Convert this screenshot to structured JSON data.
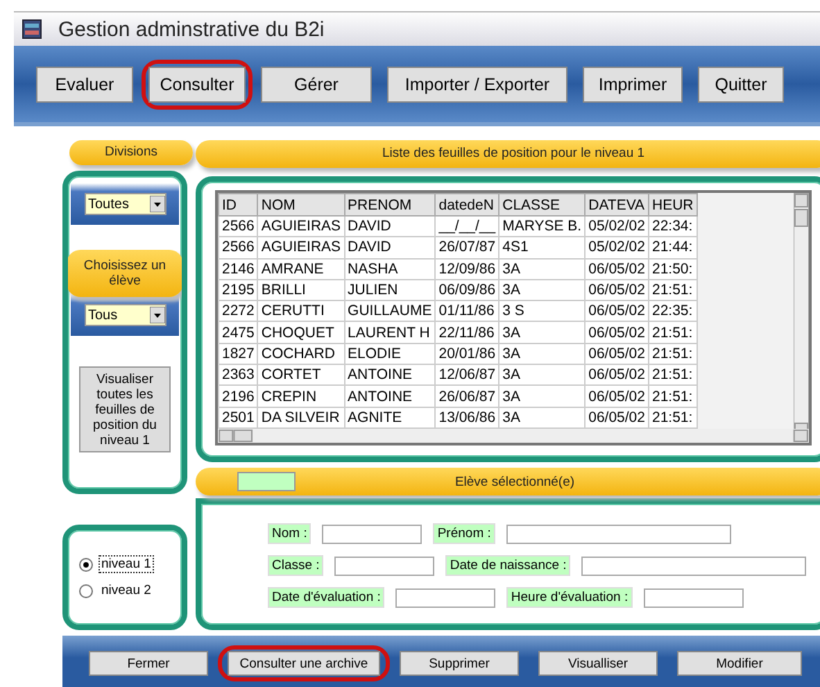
{
  "window": {
    "title": "Gestion adminstrative du B2i"
  },
  "toolbar": [
    {
      "label": "Evaluer",
      "highlighted": false
    },
    {
      "label": "Consulter",
      "highlighted": true
    },
    {
      "label": "Gérer",
      "highlighted": false
    },
    {
      "label": "Importer / Exporter",
      "highlighted": false
    },
    {
      "label": "Imprimer",
      "highlighted": false
    },
    {
      "label": "Quitter",
      "highlighted": false
    }
  ],
  "sidebar": {
    "divisions_title": "Divisions",
    "divisions_value": "Toutes",
    "choose_title": "Choisissez un élève",
    "student_value": "Tous",
    "view_all_button": "Visualiser toutes les feuilles de position du niveau 1",
    "levels": [
      {
        "label": "niveau 1",
        "selected": true
      },
      {
        "label": "niveau 2",
        "selected": false
      }
    ]
  },
  "list_title": "Liste des feuilles de position pour le niveau 1",
  "table": {
    "columns": [
      "ID",
      "NOM",
      "PRENOM",
      "datedeN",
      "CLASSE",
      "DATEVA",
      "HEUR"
    ],
    "rows": [
      [
        "2566",
        "AGUIEIRAS",
        "DAVID",
        "__/__/__",
        "MARYSE B.",
        "05/02/02",
        "22:34:"
      ],
      [
        "2566",
        "AGUIEIRAS",
        "DAVID",
        "26/07/87",
        "4S1",
        "05/02/02",
        "21:44:"
      ],
      [
        "2146",
        "AMRANE",
        "NASHA",
        "12/09/86",
        "3A",
        "06/05/02",
        "21:50:"
      ],
      [
        "2195",
        "BRILLI",
        "JULIEN",
        "06/09/86",
        "3A",
        "06/05/02",
        "21:51:"
      ],
      [
        "2272",
        "CERUTTI",
        "GUILLAUME",
        "01/11/86",
        "3 S",
        "06/05/02",
        "22:35:"
      ],
      [
        "2475",
        "CHOQUET",
        "LAURENT H",
        "22/11/86",
        "3A",
        "06/05/02",
        "21:51:"
      ],
      [
        "1827",
        "COCHARD",
        "ELODIE",
        "20/01/86",
        "3A",
        "06/05/02",
        "21:51:"
      ],
      [
        "2363",
        "CORTET",
        "ANTOINE",
        "12/06/87",
        "3A",
        "06/05/02",
        "21:51:"
      ],
      [
        "2196",
        "CREPIN",
        "ANTOINE",
        "26/06/87",
        "3A",
        "06/05/02",
        "21:51:"
      ],
      [
        "2501",
        "DA SILVEIR",
        "AGNITE",
        "13/06/86",
        "3A",
        "06/05/02",
        "21:51:"
      ]
    ]
  },
  "selected_title": "Elève sélectionné(e)",
  "fields": [
    [
      {
        "label": "Nom :"
      },
      {
        "label": "Prénom :"
      }
    ],
    [
      {
        "label": "Classe :"
      },
      {
        "label": "Date de naissance :"
      }
    ],
    [
      {
        "label": "Date d'évaluation :"
      },
      {
        "label": "Heure d'évaluation :"
      }
    ]
  ],
  "bottom_bar": [
    {
      "label": "Fermer",
      "highlighted": false
    },
    {
      "label": "Consulter une archive",
      "highlighted": true
    },
    {
      "label": "Supprimer",
      "highlighted": false
    },
    {
      "label": "Visualliser",
      "highlighted": false
    },
    {
      "label": "Modifier",
      "highlighted": false
    }
  ]
}
